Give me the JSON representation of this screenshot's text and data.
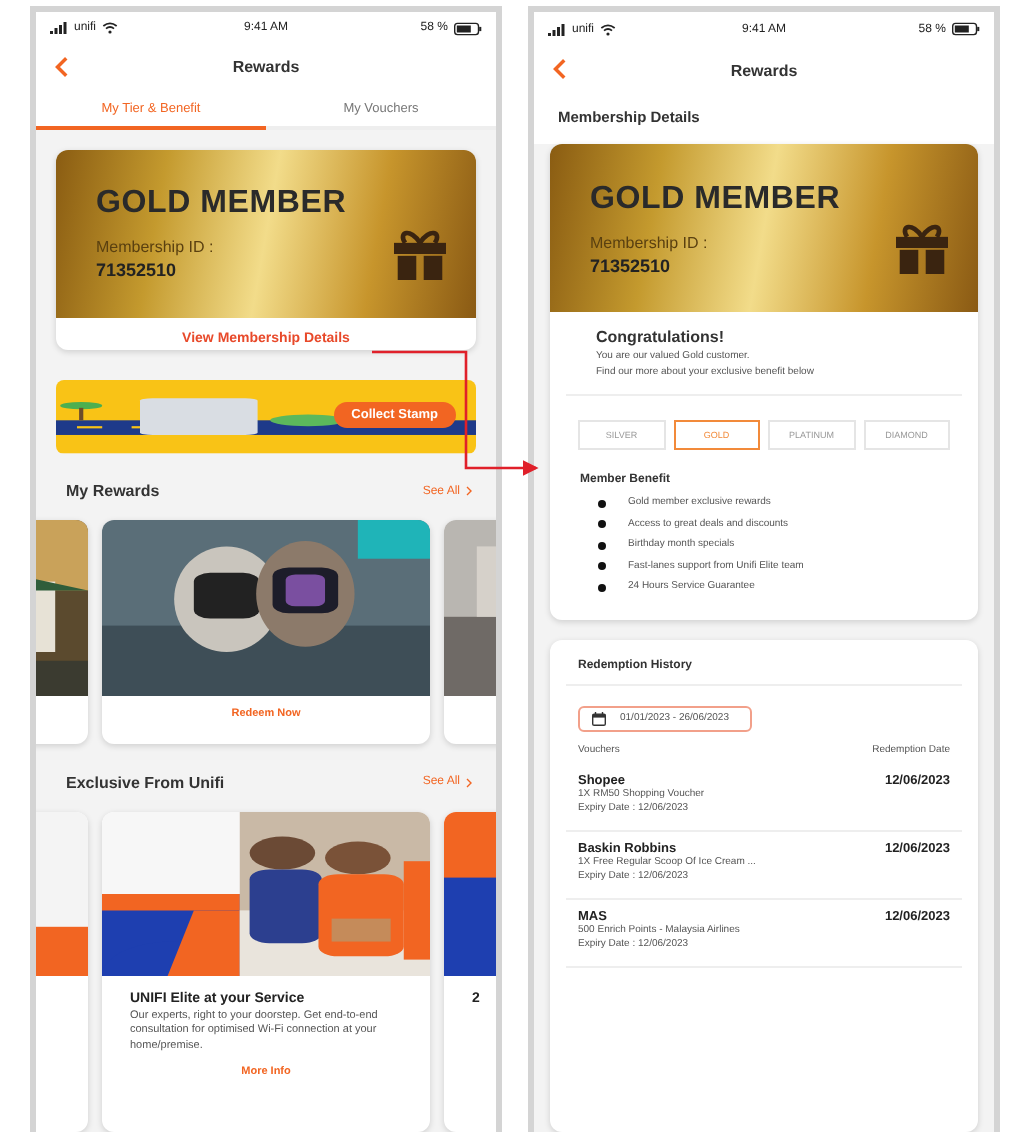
{
  "screens": [
    {
      "status_bar": {
        "carrier": "unifi",
        "time": "9:41 AM",
        "battery": "58 %"
      },
      "title": "Rewards",
      "tabs": [
        {
          "label": "My Tier & Benefit",
          "selected": true
        },
        {
          "label": "My Vouchers",
          "selected": false
        }
      ],
      "member_card": {
        "tier": "GOLD MEMBER",
        "id_label": "Membership ID :",
        "id": "71352510",
        "link": "View Membership Details"
      },
      "stamp_banner": {
        "button": "Collect Stamp"
      },
      "sections": [
        {
          "title": "My Rewards",
          "see_all": "See All",
          "kind": "rewards",
          "cards": [
            {
              "kind": "picture"
            },
            {
              "kind": "picture",
              "action": "Redeem Now"
            },
            {
              "kind": "picture"
            }
          ]
        },
        {
          "title": "Exclusive From Unifi",
          "see_all": "See All",
          "kind": "exclusive",
          "cards": [
            {
              "kind": "picture"
            },
            {
              "kind": "picture",
              "title": "UNIFI Elite at your Service",
              "text": "Our experts, right to your doorstep. Get end-to-end consultation for optimised Wi-Fi connection at your home/premise.",
              "action": "More Info"
            },
            {
              "kind": "picture",
              "title": "2"
            }
          ]
        }
      ]
    },
    {
      "status_bar": {
        "carrier": "unifi",
        "time": "9:41 AM",
        "battery": "58 %"
      },
      "title": "Rewards",
      "heading": "Membership Details",
      "member_card": {
        "tier": "GOLD MEMBER",
        "id_label": "Membership ID :",
        "id": "71352510"
      },
      "congrats": {
        "title": "Congratulations!",
        "lines": [
          "You are our valued Gold customer.",
          "Find our more about your exclusive benefit below"
        ]
      },
      "tiers": [
        {
          "label": "SILVER",
          "selected": false
        },
        {
          "label": "GOLD",
          "selected": true
        },
        {
          "label": "PLATINUM",
          "selected": false
        },
        {
          "label": "DIAMOND",
          "selected": false
        }
      ],
      "benefits": {
        "title": "Member Benefit",
        "items": [
          "Gold member exclusive rewards",
          "Access to great deals and discounts",
          "Birthday month specials",
          "Fast-lanes support from Unifi Elite team",
          "24 Hours Service Guarantee"
        ]
      },
      "history": {
        "title": "Redemption History",
        "date_range": "01/01/2023 - 26/06/2023",
        "columns": [
          "Vouchers",
          "Redemption Date"
        ],
        "rows": [
          {
            "merchant": "Shopee",
            "item": "1X RM50 Shopping Voucher",
            "expiry": "Expiry Date : 12/06/2023",
            "date": "12/06/2023"
          },
          {
            "merchant": "Baskin Robbins",
            "item": "1X Free Regular Scoop Of Ice Cream ...",
            "expiry": "Expiry Date : 12/06/2023",
            "date": "12/06/2023"
          },
          {
            "merchant": "MAS",
            "item": "500 Enrich Points - Malaysia Airlines",
            "expiry": "Expiry Date : 12/06/2023",
            "date": "12/06/2023"
          }
        ]
      }
    }
  ]
}
